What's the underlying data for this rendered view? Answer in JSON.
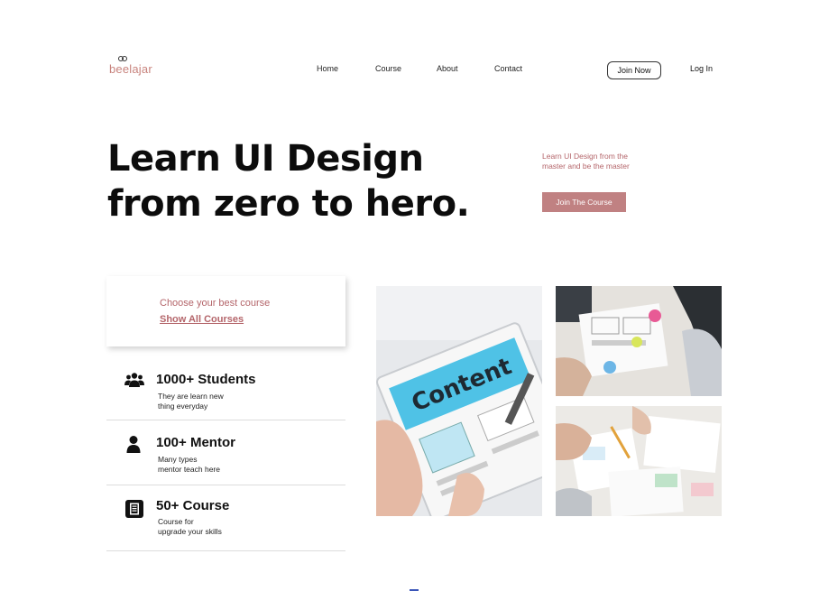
{
  "brand": {
    "name": "beelajar"
  },
  "nav": {
    "home": "Home",
    "course": "Course",
    "about": "About",
    "contact": "Contact"
  },
  "auth": {
    "join_now": "Join Now",
    "login": "Log In"
  },
  "hero": {
    "title": "Learn UI Design from zero to hero.",
    "subtitle": "Learn UI Design from the master and be the master",
    "cta": "Join The Course"
  },
  "course_card": {
    "line1": "Choose your best course",
    "link": "Show All Courses"
  },
  "stats": [
    {
      "icon": "students-icon",
      "title": "1000+ Students",
      "desc_line1": "They are learn new",
      "desc_line2": "thing everyday"
    },
    {
      "icon": "mentor-icon",
      "title": "100+ Mentor",
      "desc_line1": "Many types",
      "desc_line2": "mentor teach here"
    },
    {
      "icon": "book-icon",
      "title": "50+ Course",
      "desc_line1": "Course for",
      "desc_line2": "upgrade your skills"
    }
  ],
  "photos": {
    "p1_text": "Content"
  },
  "colors": {
    "accent": "#c08182",
    "accent_text": "#b4656a",
    "text": "#111111"
  }
}
